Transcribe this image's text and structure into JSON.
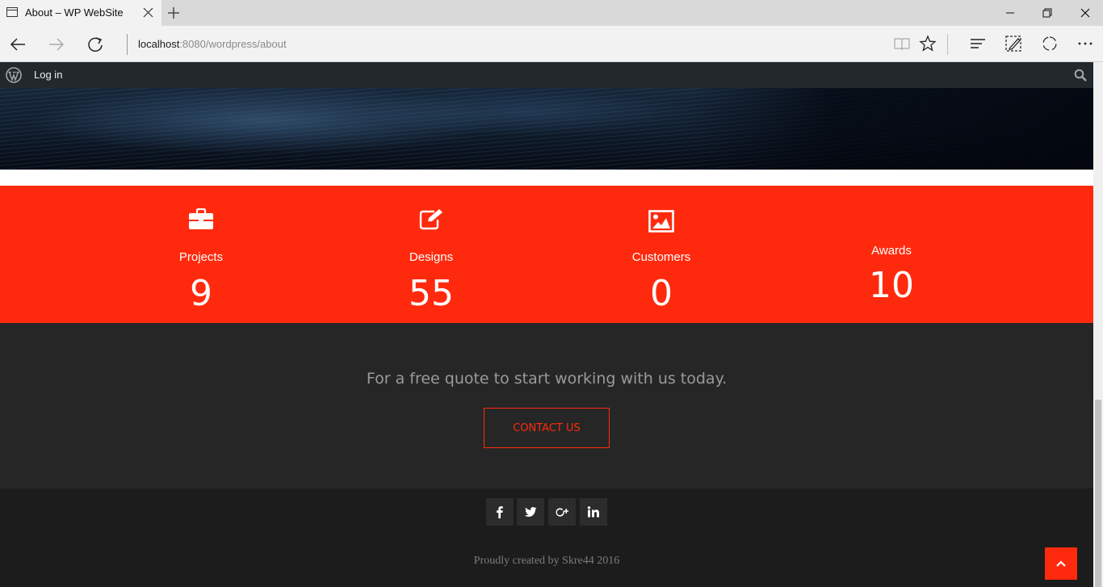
{
  "browser": {
    "tab_title": "About – WP WebSite",
    "url_host": "localhost",
    "url_path": ":8080/wordpress/about",
    "icons": [
      "page-icon",
      "close-icon",
      "plus-icon",
      "minimize-icon",
      "restore-icon",
      "window-close-icon",
      "back-icon",
      "forward-icon",
      "refresh-icon",
      "reading-view-icon",
      "favorite-star-icon",
      "hub-icon",
      "web-note-icon",
      "share-icon",
      "more-icon"
    ]
  },
  "adminbar": {
    "login_label": "Log in",
    "icons": [
      "wordpress-icon",
      "search-icon"
    ]
  },
  "stats": {
    "background_color": "#ff2a0d",
    "items": [
      {
        "label": "Projects",
        "value": "9",
        "icon": "briefcase-icon"
      },
      {
        "label": "Designs",
        "value": "55",
        "icon": "edit-icon"
      },
      {
        "label": "Customers",
        "value": "0",
        "icon": "image-icon"
      },
      {
        "label": "Awards",
        "value": "10",
        "icon": ""
      }
    ]
  },
  "cta": {
    "text": "For a free quote to start working with us today.",
    "button_label": "CONTACT US",
    "accent_color": "#ff2a0d"
  },
  "footer": {
    "social": [
      "facebook-icon",
      "twitter-icon",
      "google-plus-icon",
      "linkedin-icon"
    ],
    "copyright": "Proudly created by Skre44 2016",
    "back_to_top_icon": "chevron-up-icon"
  }
}
